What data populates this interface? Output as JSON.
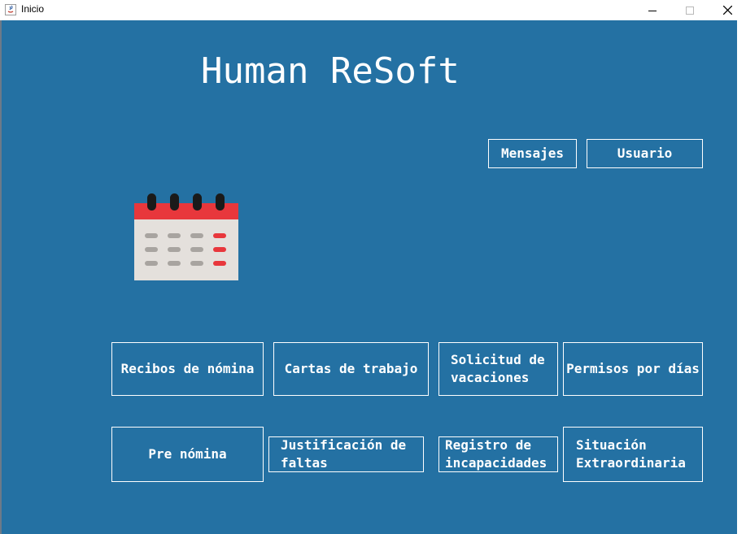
{
  "window": {
    "title": "Inicio",
    "controls": {
      "minimize": "─",
      "maximize": "☐",
      "close": "✕"
    }
  },
  "app": {
    "title": "Human ReSoft"
  },
  "top_buttons": {
    "messages": "Mensajes",
    "user": "Usuario"
  },
  "icon": {
    "name": "calendar-icon"
  },
  "menu": {
    "row1": [
      {
        "id": "recibos",
        "label": "Recibos de nómina"
      },
      {
        "id": "cartas",
        "label": "Cartas de trabajo"
      },
      {
        "id": "vacaciones",
        "lines": [
          "Solicitud de",
          "vacaciones"
        ]
      },
      {
        "id": "permisos",
        "label": "Permisos por días"
      }
    ],
    "row2": [
      {
        "id": "prenomina",
        "label": "Pre nómina"
      },
      {
        "id": "faltas",
        "lines": [
          "Justificación de",
          "faltas"
        ]
      },
      {
        "id": "incapacidades",
        "lines": [
          "Registro de",
          "incapacidades"
        ]
      },
      {
        "id": "situacion",
        "lines": [
          "Situación",
          "Extraordinaria"
        ]
      }
    ]
  },
  "colors": {
    "background": "#2471a3",
    "text": "#ffffff",
    "calendar_header": "#e8373c",
    "calendar_body": "#e4e0dc",
    "calendar_rings": "#1a1a1a",
    "calendar_dots": "#a8a4a0",
    "calendar_accent_dots": "#e8373c"
  }
}
